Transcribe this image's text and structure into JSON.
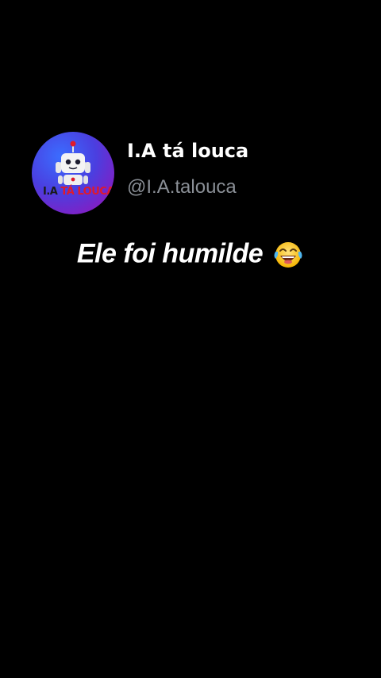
{
  "post": {
    "author": {
      "display_name": "I.A tá louca",
      "handle": "@I.A.talouca",
      "avatar": {
        "icon": "robot-icon",
        "logo_part_1": "I.A",
        "logo_part_2": "TÁ LOUCA",
        "colors": {
          "gradient_start": "#3b6dff",
          "gradient_end": "#9d1ea8",
          "logo_red": "#e01a2c"
        }
      }
    },
    "caption": {
      "text": "Ele foi humilde",
      "emoji": "face-with-tears-of-joy-icon"
    }
  },
  "theme": {
    "background": "#000000",
    "text_primary": "#ffffff",
    "text_secondary": "#8a8f96"
  }
}
